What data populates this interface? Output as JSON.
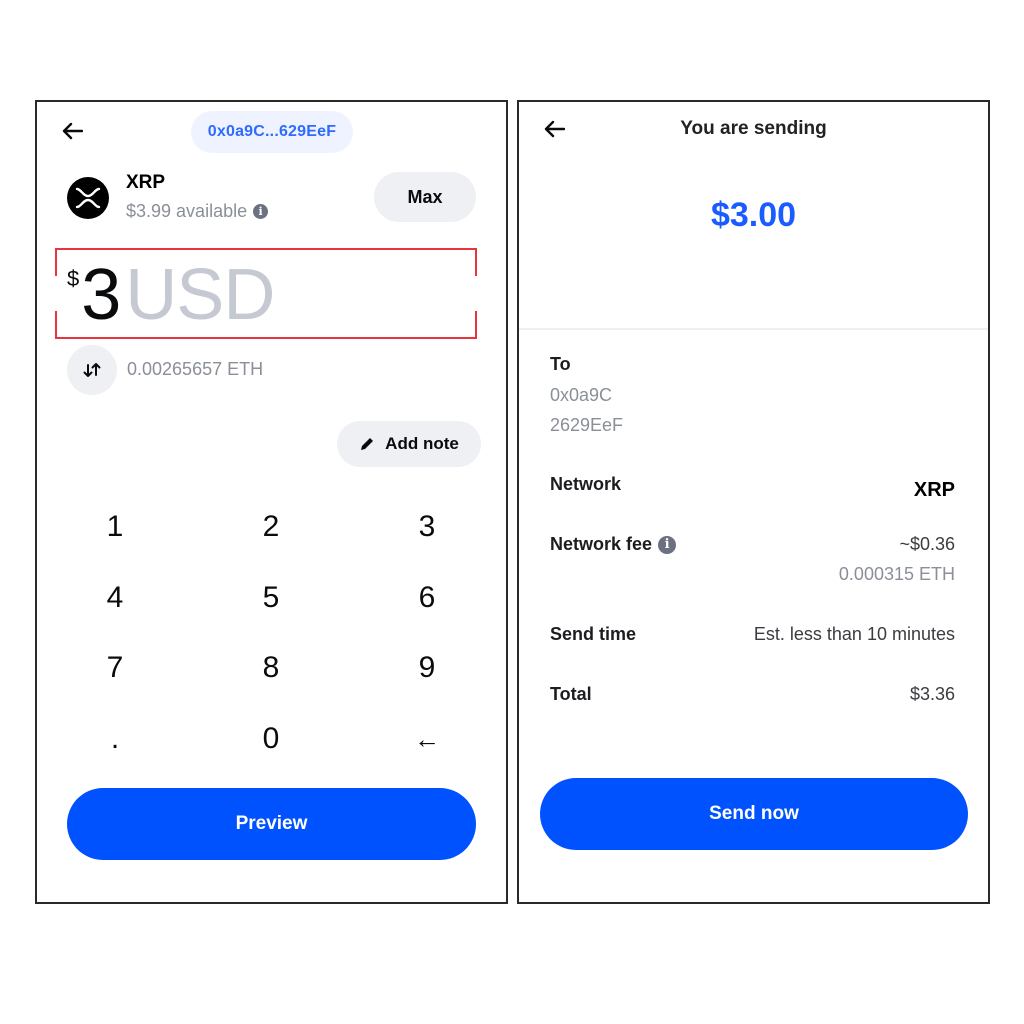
{
  "left_screen": {
    "recipient_address_short": "0x0a9C...629EeF",
    "asset": {
      "name": "XRP",
      "available": "$3.99 available",
      "icon": "xrp-logo-icon"
    },
    "max_label": "Max",
    "amount": {
      "currency_sign": "$",
      "value": "3",
      "unit": "USD"
    },
    "converted_amount": "0.00265657 ETH",
    "add_note_label": "Add note",
    "keypad": [
      "1",
      "2",
      "3",
      "4",
      "5",
      "6",
      "7",
      "8",
      "9",
      ".",
      "0",
      "←"
    ],
    "preview_label": "Preview"
  },
  "right_screen": {
    "title": "You are sending",
    "amount": "$3.00",
    "to_label": "To",
    "to_address_line1": "0x0a9C",
    "to_address_line2": "2629EeF",
    "network_label": "Network",
    "network_value": "XRP",
    "fee_label": "Network fee",
    "fee_usd": "~$0.36",
    "fee_eth": "0.000315 ETH",
    "send_time_label": "Send time",
    "send_time_value": "Est. less than 10 minutes",
    "total_label": "Total",
    "total_value": "$3.36",
    "send_label": "Send now"
  },
  "colors": {
    "primary": "#0052ff",
    "highlight_outline": "#e8343c",
    "address_pill_text": "#2f6bff"
  }
}
